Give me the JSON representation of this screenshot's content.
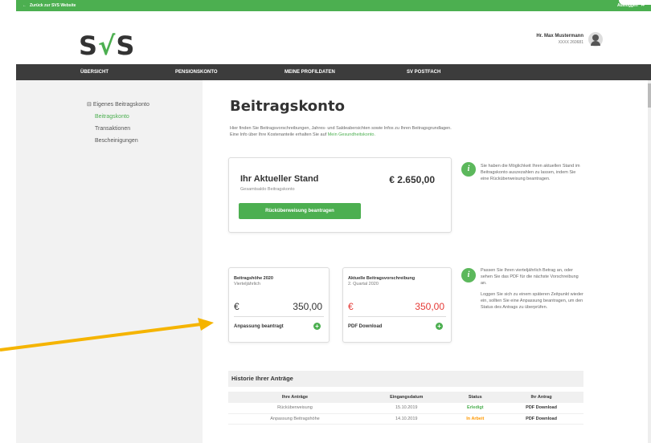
{
  "topbar": {
    "back": "Zurück zur SVS Website",
    "logout": "Ausloggen"
  },
  "header": {
    "logo_left": "S",
    "logo_slash": "√",
    "logo_right": "S",
    "user_name": "Hr. Max Mustermann",
    "user_svnr": "XXXX 260681"
  },
  "nav": {
    "items": [
      "ÜBERSICHT",
      "PENSIONSKONTO",
      "MEINE PROFILDATEN",
      "SV POSTFACH"
    ]
  },
  "sidebar": {
    "group": "Eigenes Beitragskonto",
    "items": [
      "Beitragskonto",
      "Transaktionen",
      "Bescheinigungen"
    ]
  },
  "main": {
    "title": "Beitragskonto",
    "intro": "Hier finden Sie Beitragsvorschreibungen, Jahres- und Saldeabersichten sowie Infos zu Ihren Beitragsgrundlagen.",
    "intro2": "Eine Info über Ihre Kostenanteile erhalten Sie auf ",
    "intro_link": "Mein Gesundheitskonto.",
    "stand_title": "Ihr Aktueller Stand",
    "stand_sub": "Gesamtsaldo Beitragskonto",
    "stand_amount": "€ 2.650,00",
    "stand_button": "Rücküberweisung beantragen",
    "info1": "Sie haben die Möglichkeit Ihren aktuellen Stand im Beitragskonto auszezahlen zu lassen, indem Sie eine Rücküberweisung beantragen.",
    "card1": {
      "title": "Beitragshöhe 2020",
      "sub": "Vierteljährlich",
      "currency": "€",
      "value": "350,00",
      "footer": "Anpassung beantragt"
    },
    "card2": {
      "title": "Aktuelle Beitragsvorschreibung",
      "sub": "2. Quartal 2020",
      "currency": "€",
      "value": "350,00",
      "footer": "PDF Download"
    },
    "info2a": "Passen Sie Ihren vierteljährlich Betrag an, oder sehen Sie das PDF für die nächste Vorschreibung an.",
    "info2b": "Loggen Sie sich zu einem späteren Zeitpunkt wieder ein, sollten Sie eine Anpassung beantragen, um den Status des Antrags zu überprüfen.",
    "history": {
      "title": "Historie Ihrer Anträge",
      "columns": [
        "Ihre Anträge",
        "Eingangsdatum",
        "Status",
        "Ihr Antrag"
      ],
      "rows": [
        [
          "Rücküberweisung",
          "15.10.2019",
          "Erledigt",
          "PDF Download"
        ],
        [
          "Anpassung Beitragshöhe",
          "14.10.2019",
          "In Arbeit",
          "PDF Download"
        ]
      ]
    }
  },
  "colors": {
    "accent": "#4caf50",
    "nav": "#3c3c3c",
    "arrow": "#f5b400",
    "red": "#e53935",
    "orange": "#ff9800"
  }
}
